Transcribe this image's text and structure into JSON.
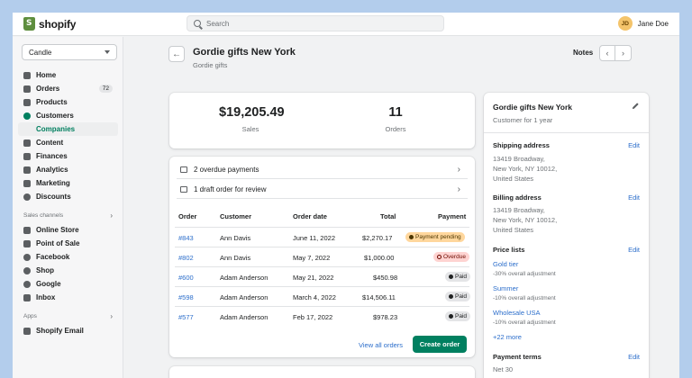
{
  "topbar": {
    "brand": "shopify",
    "search_placeholder": "Search",
    "user_initials": "JD",
    "user_name": "Jane Doe"
  },
  "sidebar": {
    "store": "Candle",
    "items": [
      {
        "label": "Home",
        "icon": "home-icon"
      },
      {
        "label": "Orders",
        "icon": "orders-icon",
        "badge": "72"
      },
      {
        "label": "Products",
        "icon": "tag-icon"
      },
      {
        "label": "Customers",
        "icon": "person-icon"
      },
      {
        "label": "Companies",
        "icon": "",
        "sub": true
      },
      {
        "label": "Content",
        "icon": "content-icon"
      },
      {
        "label": "Finances",
        "icon": "finances-icon"
      },
      {
        "label": "Analytics",
        "icon": "analytics-icon"
      },
      {
        "label": "Marketing",
        "icon": "marketing-icon"
      },
      {
        "label": "Discounts",
        "icon": "discount-icon"
      }
    ],
    "sales_channels_label": "Sales channels",
    "channels": [
      {
        "label": "Online Store",
        "icon": "store-icon"
      },
      {
        "label": "Point of Sale",
        "icon": "pos-icon"
      },
      {
        "label": "Facebook",
        "icon": "facebook-icon"
      },
      {
        "label": "Shop",
        "icon": "shop-icon"
      },
      {
        "label": "Google",
        "icon": "google-icon"
      },
      {
        "label": "Inbox",
        "icon": "inbox-icon"
      }
    ],
    "apps_label": "Apps",
    "apps": [
      {
        "label": "Shopify Email",
        "icon": "email-icon"
      }
    ]
  },
  "header": {
    "title": "Gordie gifts New York",
    "subtitle": "Gordie gifts",
    "notes": "Notes"
  },
  "stats": {
    "sales_value": "$19,205.49",
    "sales_label": "Sales",
    "orders_value": "11",
    "orders_label": "Orders"
  },
  "alerts": [
    "2 overdue payments",
    "1 draft order for review"
  ],
  "table": {
    "headers": {
      "order": "Order",
      "customer": "Customer",
      "date": "Order date",
      "total": "Total",
      "payment": "Payment"
    },
    "rows": [
      {
        "order": "#843",
        "customer": "Ann Davis",
        "date": "June 11, 2022",
        "total": "$2,270.17",
        "payment": "Payment pending",
        "status": "pending"
      },
      {
        "order": "#802",
        "customer": "Ann Davis",
        "date": "May 7, 2022",
        "total": "$1,000.00",
        "payment": "Overdue",
        "status": "overdue"
      },
      {
        "order": "#600",
        "customer": "Adam Anderson",
        "date": "May 21, 2022",
        "total": "$450.98",
        "payment": "Paid",
        "status": "paid"
      },
      {
        "order": "#598",
        "customer": "Adam Anderson",
        "date": "March 4, 2022",
        "total": "$14,506.11",
        "payment": "Paid",
        "status": "paid"
      },
      {
        "order": "#577",
        "customer": "Adam Anderson",
        "date": "Feb 17, 2022",
        "total": "$978.23",
        "payment": "Paid",
        "status": "paid"
      }
    ],
    "view_all": "View all orders",
    "create_order": "Create order"
  },
  "company": {
    "name": "Gordie gifts New York",
    "since": "Customer for 1 year",
    "edit_label": "Edit",
    "shipping_title": "Shipping address",
    "shipping_lines": [
      "13419 Broadway,",
      "New York, NY 10012,",
      "United States"
    ],
    "billing_title": "Billing address",
    "billing_lines": [
      "13419 Broadway,",
      "New York, NY 10012,",
      "United States"
    ],
    "price_lists_title": "Price lists",
    "price_lists": [
      {
        "name": "Gold tier",
        "adjustment": "-30% overall adjustment"
      },
      {
        "name": "Summer",
        "adjustment": "-10% overall adjustment"
      },
      {
        "name": "Wholesale USA",
        "adjustment": "-10% overall adjustment"
      }
    ],
    "more": "+22 more",
    "payment_terms_title": "Payment terms",
    "payment_terms": "Net 30"
  },
  "colors": {
    "accent": "#008060",
    "link": "#2c6ecb",
    "brand": "#5e8e3e",
    "background": "#b3cdec"
  }
}
